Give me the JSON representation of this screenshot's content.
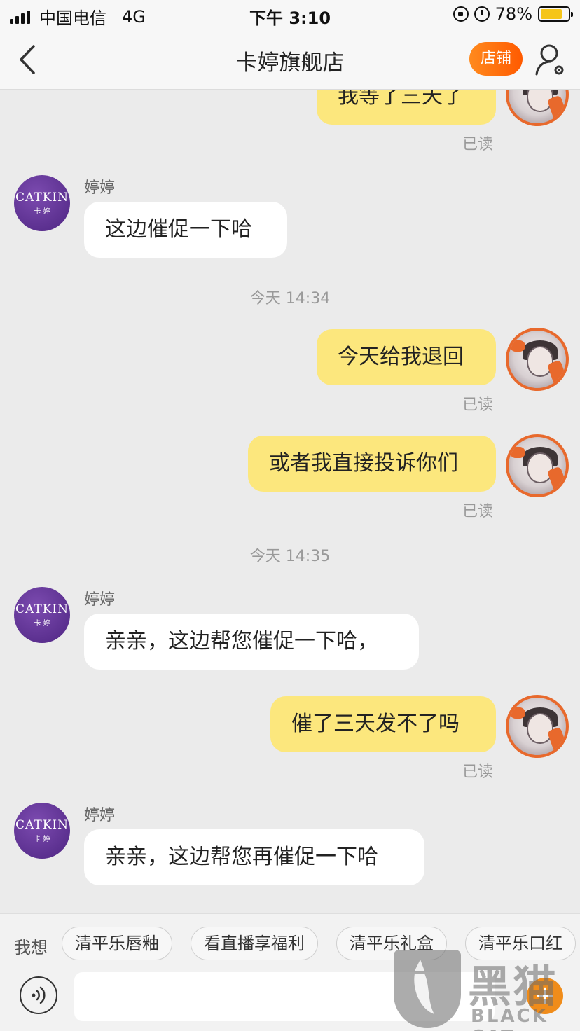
{
  "status_bar": {
    "carrier": "中国电信",
    "network": "4G",
    "time": "下午 3:10",
    "battery_percent": "78%",
    "battery_level": 0.78
  },
  "nav": {
    "title": "卡婷旗舰店",
    "shop_label": "店铺",
    "icons": [
      "back-chevron-icon",
      "user-settings-icon"
    ],
    "accent_color": "#ff6a00"
  },
  "chat": {
    "shop_avatar_brand": "CATKIN",
    "shop_avatar_sub": "卡 婷",
    "messages": [
      {
        "from": "me",
        "text": "我等了三天了",
        "status": "已读"
      },
      {
        "from": "them",
        "sender": "婷婷",
        "text": "这边催促一下哈"
      },
      {
        "type": "time",
        "text": "今天 14:34"
      },
      {
        "from": "me",
        "text": "今天给我退回",
        "status": "已读"
      },
      {
        "from": "me",
        "text": "或者我直接投诉你们",
        "status": "已读"
      },
      {
        "type": "time",
        "text": "今天 14:35"
      },
      {
        "from": "them",
        "sender": "婷婷",
        "text": "亲亲，这边帮您催促一下哈，"
      },
      {
        "from": "me",
        "text": "催了三天发不了吗",
        "status": "已读"
      },
      {
        "from": "them",
        "sender": "婷婷",
        "text": "亲亲，这边帮您再催促一下哈"
      }
    ],
    "my_bubble_color": "#fce77d",
    "their_bubble_color": "#ffffff"
  },
  "suggestions": {
    "label": "我想",
    "chips": [
      "清平乐唇釉",
      "看直播享福利",
      "清平乐礼盒",
      "清平乐口红"
    ]
  },
  "input": {
    "placeholder": ""
  },
  "watermark": {
    "zh": "黑猫",
    "en": "BLACK CAT"
  }
}
